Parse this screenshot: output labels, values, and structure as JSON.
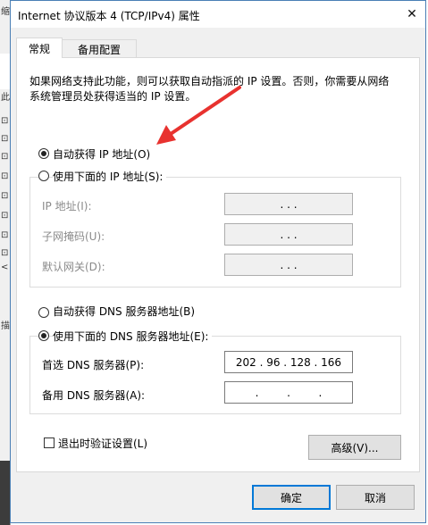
{
  "background_window": {
    "marks": [
      "缩",
      "此",
      "⊡",
      "⊡",
      "⊡",
      "⊡",
      "⊡",
      "⊡",
      "⊡",
      "⊡",
      "<",
      "描"
    ]
  },
  "dialog": {
    "title": "Internet 协议版本 4 (TCP/IPv4) 属性",
    "close_symbol": "✕",
    "tabs": [
      {
        "label": "常规",
        "active": true
      },
      {
        "label": "备用配置",
        "active": false
      }
    ],
    "description": "如果网络支持此功能，则可以获取自动指派的 IP 设置。否则，你需要从网络系统管理员处获得适当的 IP 设置。",
    "ip_mode": {
      "auto_label": "自动获得 IP 地址(O)",
      "auto_selected": true,
      "manual_label": "使用下面的 IP 地址(S):",
      "manual_selected": false
    },
    "ip_fields": [
      {
        "label": "IP 地址(I):",
        "value": ".    .    ."
      },
      {
        "label": "子网掩码(U):",
        "value": ".    .    ."
      },
      {
        "label": "默认网关(D):",
        "value": ".    .    ."
      }
    ],
    "dns_mode": {
      "auto_label": "自动获得 DNS 服务器地址(B)",
      "auto_selected": false,
      "manual_label": "使用下面的 DNS 服务器地址(E):",
      "manual_selected": true
    },
    "dns_fields": [
      {
        "label": "首选 DNS 服务器(P):",
        "octets": [
          "202",
          "96",
          "128",
          "166"
        ]
      },
      {
        "label": "备用 DNS 服务器(A):",
        "octets": [
          "",
          "",
          "",
          ""
        ]
      }
    ],
    "validate_label": "退出时验证设置(L)",
    "validate_checked": false,
    "advanced_button": "高级(V)...",
    "ok_button": "确定",
    "cancel_button": "取消",
    "annotation_color": "#e8322f"
  }
}
